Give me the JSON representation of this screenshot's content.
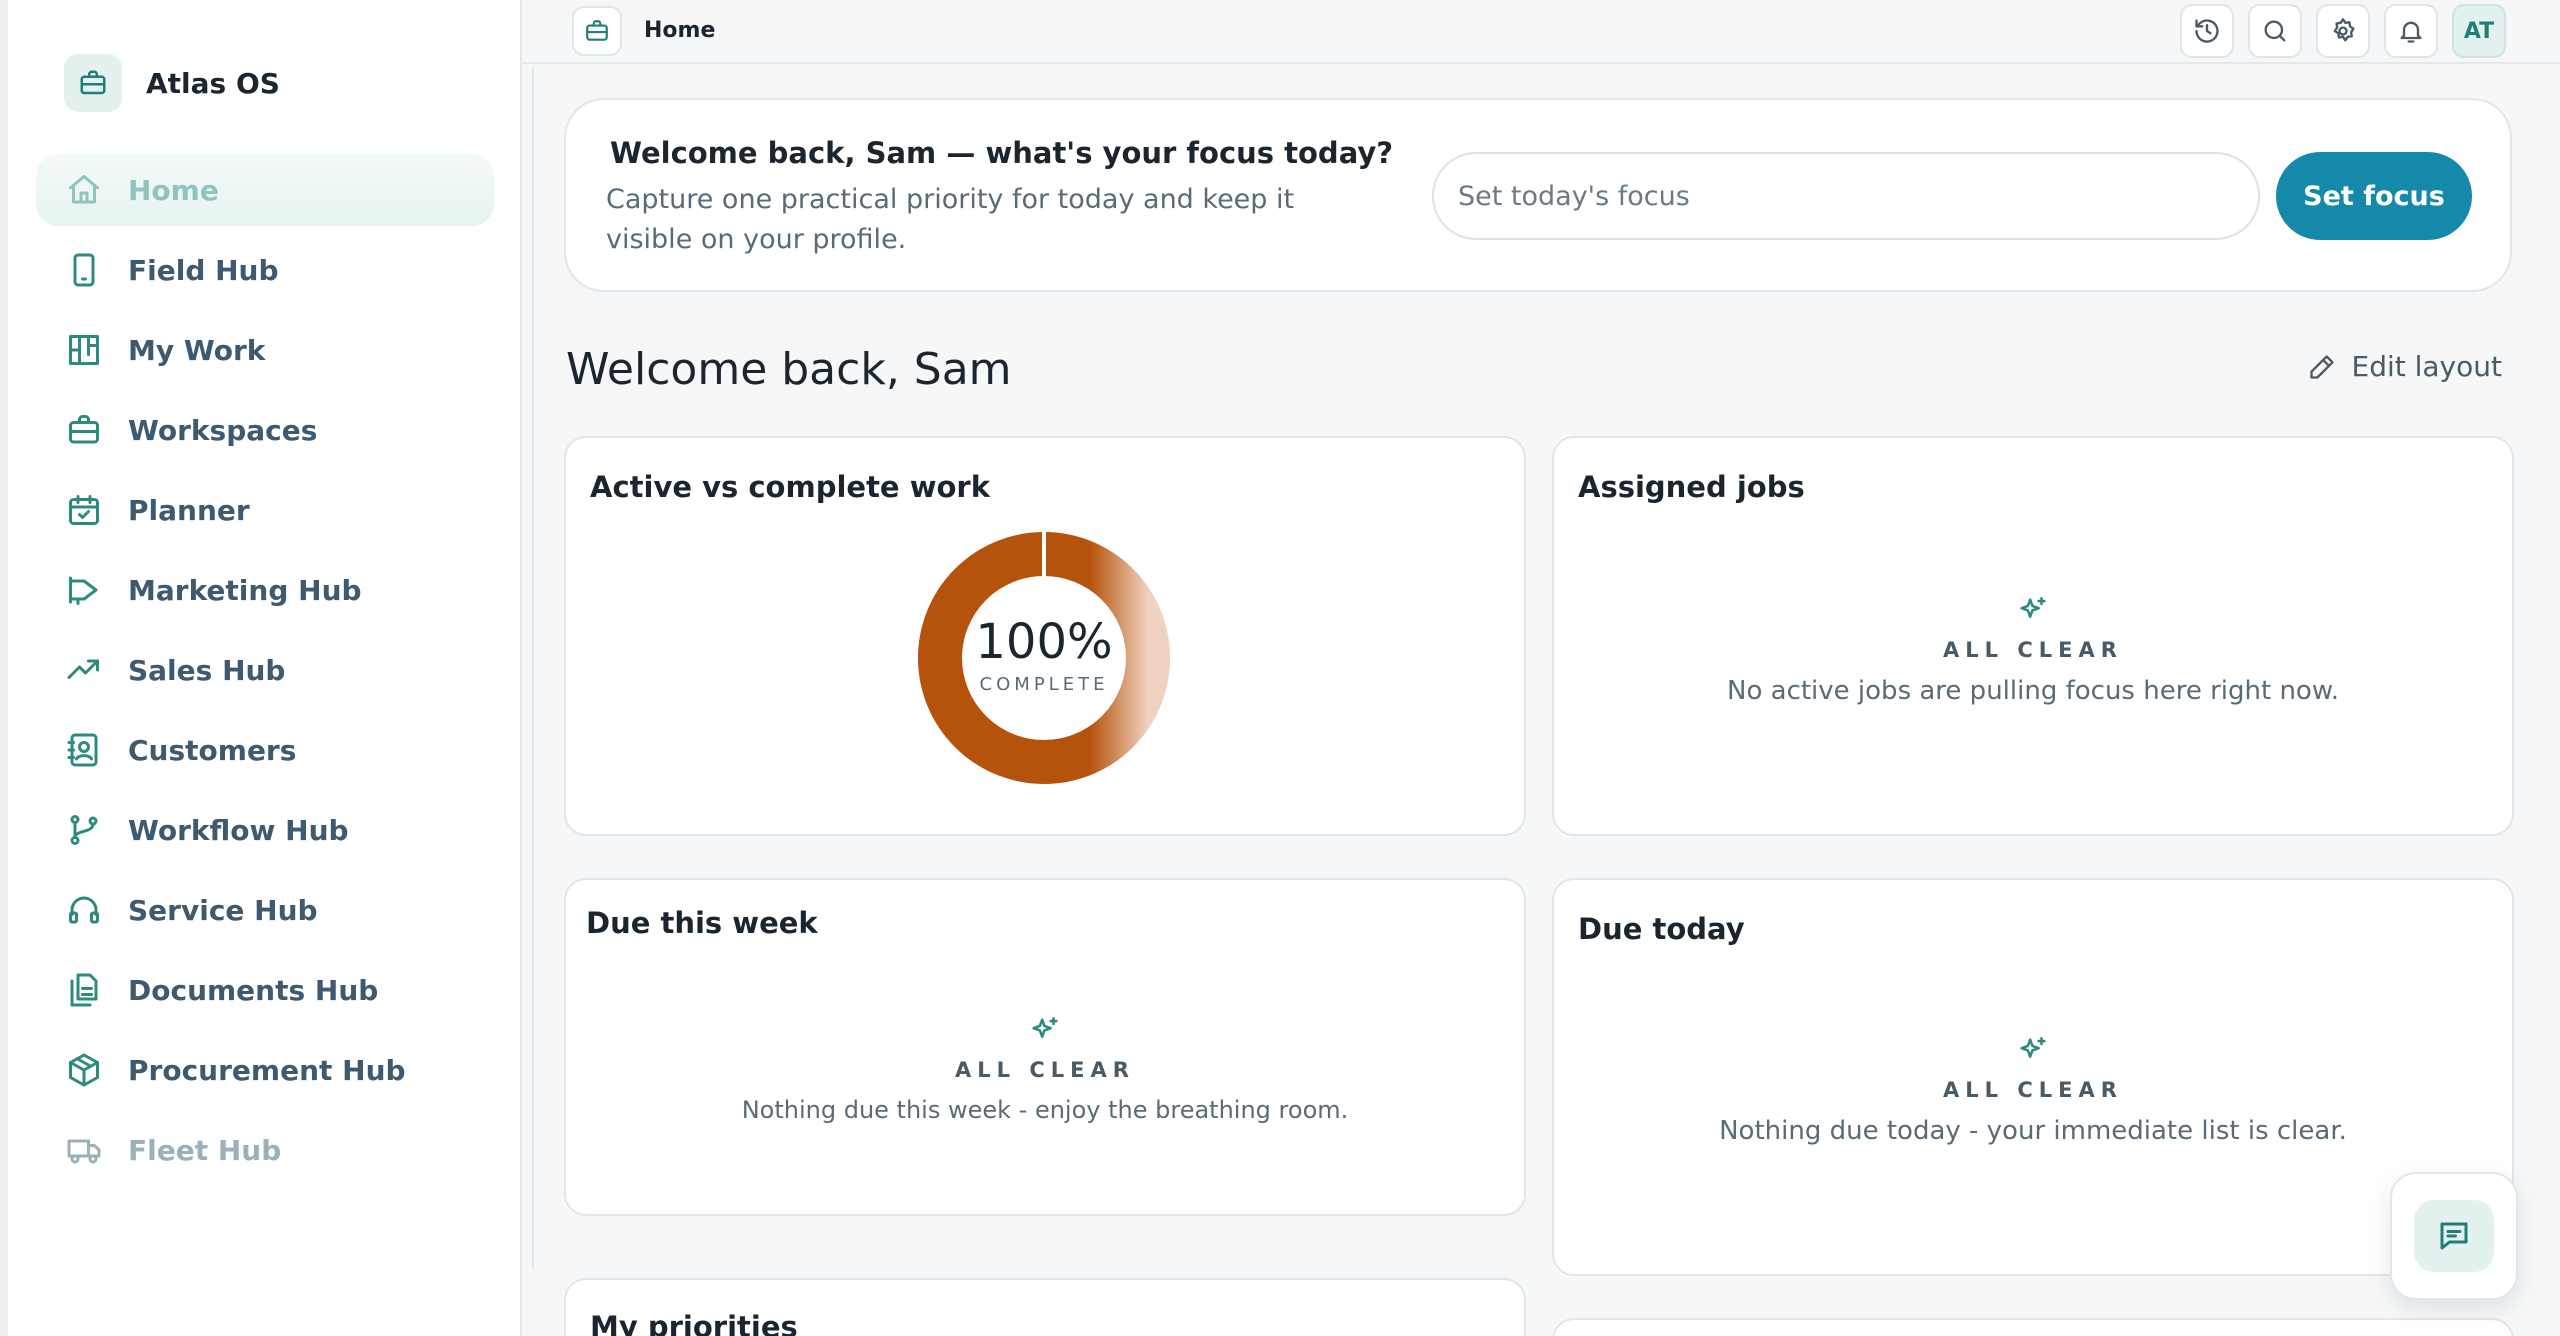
{
  "app": {
    "name": "Atlas OS"
  },
  "colors": {
    "accent": "#1589aa",
    "brand": "#1e7f74",
    "donut": "#b5520b"
  },
  "sidebar": {
    "items": [
      {
        "label": "Home",
        "icon": "home-icon"
      },
      {
        "label": "Field Hub",
        "icon": "phone-icon"
      },
      {
        "label": "My Work",
        "icon": "kanban-icon"
      },
      {
        "label": "Workspaces",
        "icon": "briefcase-icon"
      },
      {
        "label": "Planner",
        "icon": "calendar-check-icon"
      },
      {
        "label": "Marketing Hub",
        "icon": "megaphone-icon"
      },
      {
        "label": "Sales Hub",
        "icon": "trending-up-icon"
      },
      {
        "label": "Customers",
        "icon": "contact-book-icon"
      },
      {
        "label": "Workflow Hub",
        "icon": "git-branch-icon"
      },
      {
        "label": "Service Hub",
        "icon": "headset-icon"
      },
      {
        "label": "Documents Hub",
        "icon": "documents-icon"
      },
      {
        "label": "Procurement Hub",
        "icon": "package-icon"
      },
      {
        "label": "Fleet Hub",
        "icon": "truck-icon"
      }
    ]
  },
  "topbar": {
    "title": "Home",
    "avatar": "AT"
  },
  "focus": {
    "heading": "Welcome back, Sam — what's your focus today?",
    "description": "Capture one practical priority for today and keep it visible on your profile.",
    "placeholder": "Set today's focus",
    "button": "Set focus"
  },
  "main": {
    "title": "Welcome back, Sam",
    "edit_layout": "Edit layout",
    "cards": {
      "active": {
        "title": "Active vs complete work",
        "percent": "100%",
        "sub": "COMPLETE",
        "complete_fraction": 1.0
      },
      "assigned": {
        "title": "Assigned jobs",
        "caps": "ALL CLEAR",
        "msg": "No active jobs are pulling focus here right now."
      },
      "week": {
        "title": "Due this week",
        "caps": "ALL CLEAR",
        "msg": "Nothing due this week - enjoy the breathing room."
      },
      "today": {
        "title": "Due today",
        "caps": "ALL CLEAR",
        "msg": "Nothing due today - your immediate list is clear."
      },
      "priorities": {
        "title": "My priorities"
      }
    }
  }
}
